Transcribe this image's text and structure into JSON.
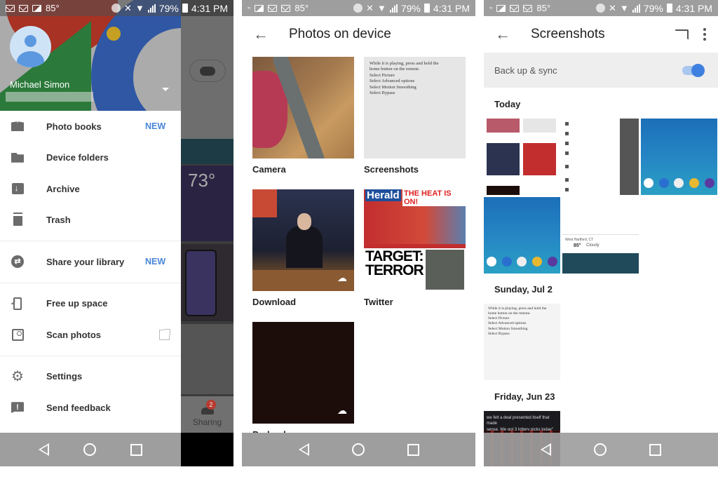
{
  "status_bar": {
    "temperature": "85°",
    "battery": "79%",
    "time": "4:31 PM",
    "network": "4G"
  },
  "navbar": {
    "back": "back-button",
    "home": "home-button",
    "recents": "recents-button"
  },
  "panel1": {
    "account": {
      "name": "Michael Simon"
    },
    "menu": [
      {
        "label": "Photo books",
        "icon": "photo-book-icon",
        "badge": "NEW"
      },
      {
        "label": "Device folders",
        "icon": "folder-icon"
      },
      {
        "label": "Archive",
        "icon": "archive-icon"
      },
      {
        "label": "Trash",
        "icon": "trash-icon"
      },
      {
        "label": "Share your library",
        "icon": "share-library-icon",
        "badge": "NEW"
      },
      {
        "label": "Free up space",
        "icon": "free-space-icon"
      },
      {
        "label": "Scan photos",
        "icon": "scan-photos-icon",
        "trailing": "external-link-icon"
      },
      {
        "label": "Settings",
        "icon": "settings-icon"
      },
      {
        "label": "Send feedback",
        "icon": "feedback-icon"
      }
    ],
    "background": {
      "weather_temp": "73°",
      "sharing_label": "Sharing",
      "sharing_count": "2"
    }
  },
  "panel2": {
    "title": "Photos on device",
    "folders": [
      {
        "label": "Camera"
      },
      {
        "label": "Screenshots",
        "doc_lines": [
          "While it is playing, press and hold the",
          "home button on the remote.",
          "Select Picture",
          "Select Advanced options",
          "Select Motion Smoothing",
          "Select Bypass"
        ]
      },
      {
        "label": "Download"
      },
      {
        "label": "Twitter",
        "masthead": "Herald",
        "headline": "THE HEAT IS ON!",
        "cover": "TARGET: TERROR"
      },
      {
        "label": "Preload"
      }
    ]
  },
  "panel3": {
    "title": "Screenshots",
    "sync_label": "Back up & sync",
    "sync_enabled": true,
    "sections": [
      {
        "heading": "Today"
      },
      {
        "heading": "Sunday, Jul 2",
        "doc_lines": [
          "While it is playing, press and hold the",
          "home button on the remote.",
          "Select Picture",
          "Select Advanced options",
          "Select Motion Smoothing",
          "Select Bypass"
        ]
      },
      {
        "heading": "Friday, Jun 23",
        "tweet_lines": [
          "we felt a deal presented itself that made",
          "sense. We got 3 lottery picks today\""
        ]
      }
    ],
    "weather_mini": {
      "location": "West Hartford, CT",
      "temp": "85°",
      "condition": "Cloudy"
    }
  }
}
